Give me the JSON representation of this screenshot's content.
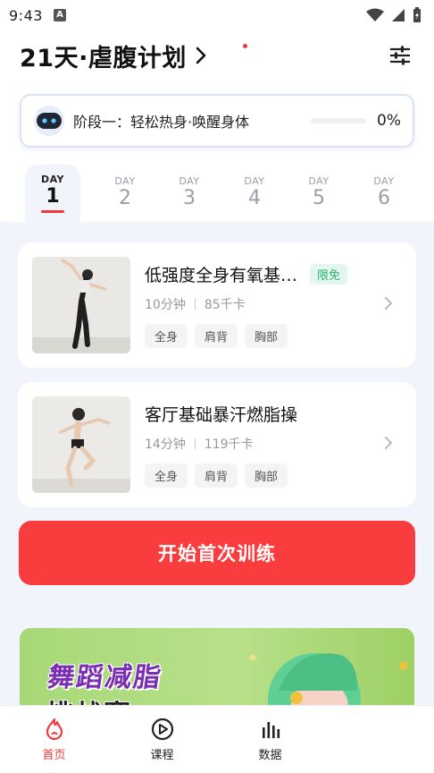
{
  "status_bar": {
    "time": "9:43",
    "notif_icon": "A"
  },
  "header": {
    "title": "21天·虐腹计划"
  },
  "stage": {
    "label": "阶段一：轻松热身·唤醒身体",
    "progress_text": "0%",
    "progress_fraction": 0
  },
  "day_tabs": [
    {
      "label": "DAY",
      "num": "1",
      "active": true
    },
    {
      "label": "DAY",
      "num": "2",
      "active": false
    },
    {
      "label": "DAY",
      "num": "3",
      "active": false
    },
    {
      "label": "DAY",
      "num": "4",
      "active": false
    },
    {
      "label": "DAY",
      "num": "5",
      "active": false
    },
    {
      "label": "DAY",
      "num": "6",
      "active": false
    }
  ],
  "workouts": [
    {
      "title": "低强度全身有氧基…",
      "badge": "限免",
      "duration": "10分钟",
      "calories": "85千卡",
      "tags": [
        "全身",
        "肩背",
        "胸部"
      ]
    },
    {
      "title": "客厅基础暴汗燃脂操",
      "badge": "",
      "duration": "14分钟",
      "calories": "119千卡",
      "tags": [
        "全身",
        "肩背",
        "胸部"
      ]
    }
  ],
  "start_button": "开始首次训练",
  "banner": {
    "line1": "舞蹈减脂",
    "line2": "挑战赛"
  },
  "bottom_nav": [
    {
      "label": "首页",
      "icon": "home-flame-icon",
      "active": true
    },
    {
      "label": "课程",
      "icon": "play-circle-icon",
      "active": false
    },
    {
      "label": "数据",
      "icon": "bar-chart-icon",
      "active": false
    }
  ],
  "colors": {
    "accent": "#f93d3f",
    "badge_green": "#2bb36f",
    "tab_bg": "#f1f4fa"
  }
}
